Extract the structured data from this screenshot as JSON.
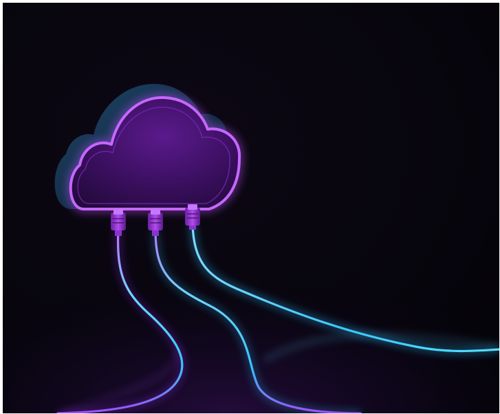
{
  "image": {
    "subject": "cloud-with-network-cables",
    "colors": {
      "background": "#06040b",
      "accent_purple": "#b24cf0",
      "accent_cyan": "#39d8ff",
      "cloud_fill": "#3a0f5e",
      "cloud_body_dark": "#12233d"
    }
  }
}
